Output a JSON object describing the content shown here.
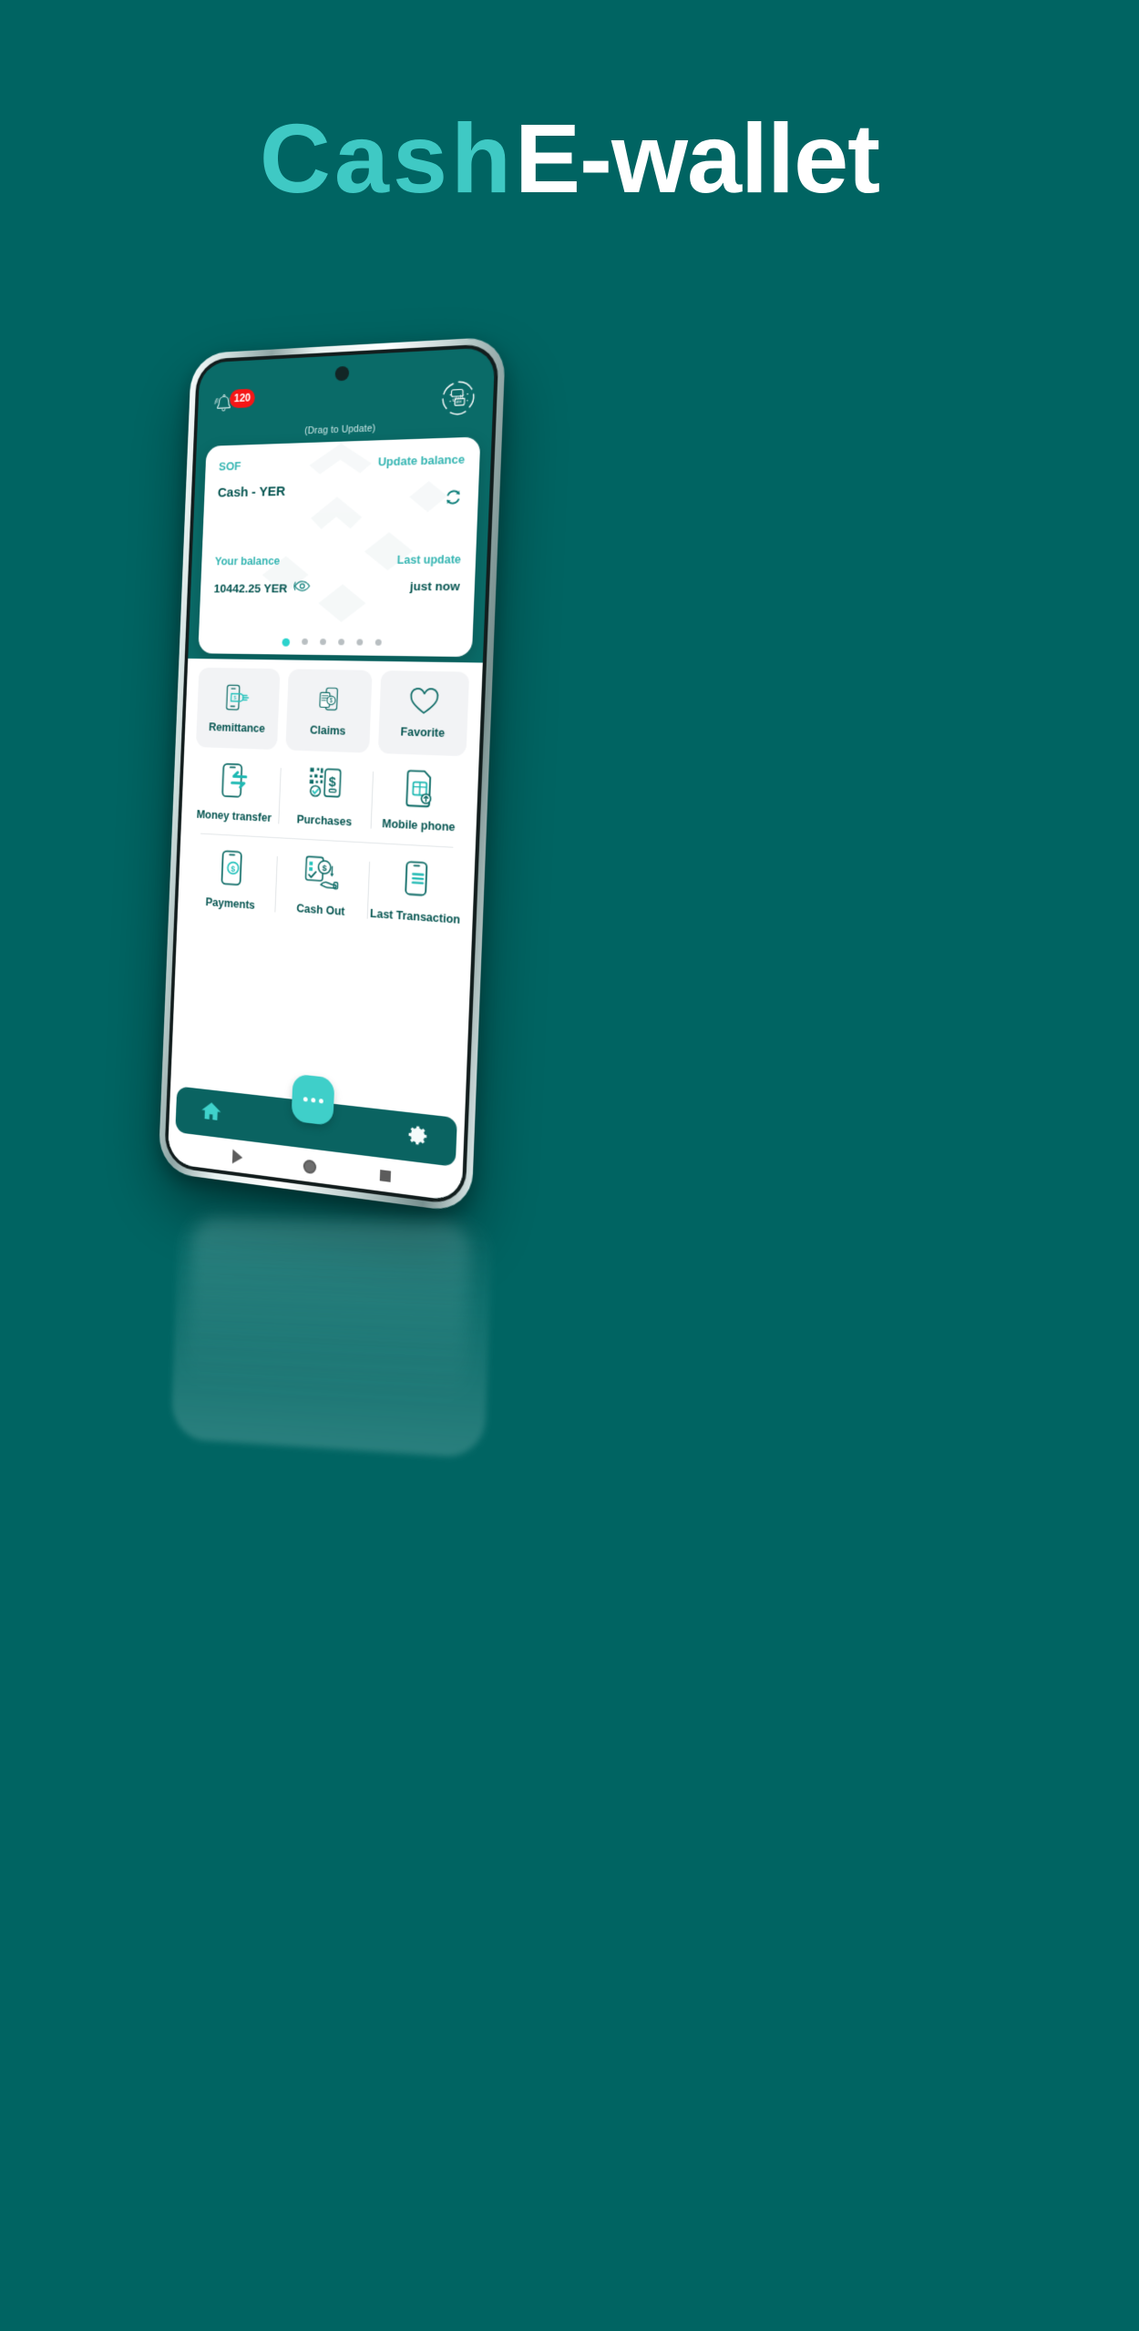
{
  "page": {
    "background_color": "#006462",
    "accent_color": "#3fc9c4"
  },
  "hero": {
    "title_part1": "Cash",
    "title_part2": "E-wallet"
  },
  "phone": {
    "status": {
      "notification_icon": "bell-icon",
      "notification_count": "120",
      "logo_icon": "cash-app-logo",
      "logo_arabic_text": "كاش"
    },
    "drag_hint": "(Drag to Update)",
    "balance_card": {
      "source_label": "SOF",
      "source_value": "Cash - YER",
      "update_label": "Update balance",
      "update_icon": "refresh-icon",
      "balance_label": "Your balance",
      "balance_value": "10442.25 YER",
      "visibility_icon": "eye-icon",
      "last_update_label": "Last update",
      "last_update_value": "just now",
      "page_dots_total": 6,
      "page_dots_active": 1
    },
    "quick_tiles": [
      {
        "label": "Remittance",
        "icon": "remittance-icon"
      },
      {
        "label": "Claims",
        "icon": "claims-icon"
      },
      {
        "label": "Favorite",
        "icon": "heart-icon"
      }
    ],
    "services_row_1": [
      {
        "label": "Money transfer",
        "icon": "money-transfer-icon"
      },
      {
        "label": "Purchases",
        "icon": "purchases-qr-icon"
      },
      {
        "label": "Mobile phone",
        "icon": "sim-card-icon"
      }
    ],
    "services_row_2": [
      {
        "label": "Payments",
        "icon": "payments-icon"
      },
      {
        "label": "Cash Out",
        "icon": "cash-out-icon"
      },
      {
        "label": "Last Transaction",
        "icon": "last-transaction-icon"
      }
    ],
    "fab": {
      "icon": "more-dots-icon"
    },
    "bottom_nav": [
      {
        "name": "home",
        "icon": "home-icon"
      },
      {
        "name": "settings",
        "icon": "gear-icon"
      }
    ],
    "android_nav": [
      {
        "name": "back",
        "icon": "triangle-back-icon"
      },
      {
        "name": "home",
        "icon": "circle-home-icon"
      },
      {
        "name": "recents",
        "icon": "square-recents-icon"
      }
    ]
  }
}
